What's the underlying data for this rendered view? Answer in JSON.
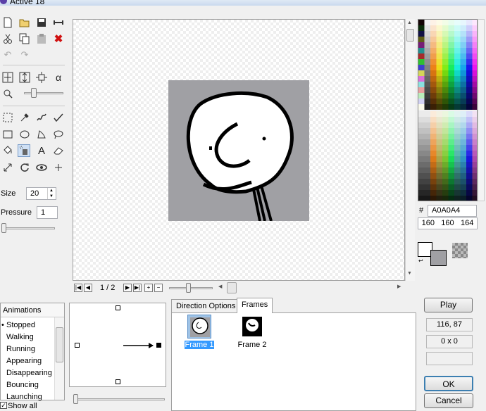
{
  "window": {
    "title": "Active 18"
  },
  "toolbar": {
    "file_tools": [
      "new-file-icon",
      "open-folder-icon",
      "save-icon",
      "link-icon"
    ],
    "edit_tools": [
      "cut-icon",
      "copy-icon",
      "paste-icon",
      "delete-icon"
    ],
    "history_tools": [
      "undo-icon",
      "redo-icon"
    ],
    "transform_tools": [
      "flip-horizontal-icon",
      "flip-vertical-icon",
      "resize-icon",
      "alpha-icon"
    ],
    "draw_tools_row1": [
      "selection-icon",
      "eyedropper-icon",
      "brush-icon",
      "pen-icon"
    ],
    "draw_tools_row2": [
      "rectangle-icon",
      "ellipse-icon",
      "shape-icon",
      "lasso-icon"
    ],
    "draw_tools_row3": [
      "fill-bucket-icon",
      "spray-icon",
      "text-icon",
      "eraser-icon"
    ],
    "draw_tools_row4": [
      "line-icon",
      "rotate-icon",
      "eye-icon",
      "hotspot-icon"
    ],
    "selected_tool": "spray-icon",
    "size_label": "Size",
    "size_value": "20",
    "pressure_label": "Pressure",
    "pressure_value": "1"
  },
  "navigation": {
    "frame_counter": "1 / 2"
  },
  "color": {
    "hash": "#",
    "hex": "A0A0A4",
    "r": "160",
    "g": "160",
    "b": "164",
    "foreground": "#ffffff",
    "background": "#a0a0a4"
  },
  "animations": {
    "header": "Animations",
    "items": [
      "Stopped",
      "Walking",
      "Running",
      "Appearing",
      "Disappearing",
      "Bouncing",
      "Launching"
    ],
    "selected": "Stopped",
    "show_all_label": "Show all"
  },
  "tabs": {
    "direction_options": "Direction Options",
    "frames": "Frames",
    "active": "Frames"
  },
  "frames": [
    {
      "label": "Frame 1",
      "selected": true
    },
    {
      "label": "Frame 2",
      "selected": false
    }
  ],
  "side": {
    "play_label": "Play",
    "coords": "116, 87",
    "size": "0 x 0",
    "ok_label": "OK",
    "cancel_label": "Cancel"
  }
}
